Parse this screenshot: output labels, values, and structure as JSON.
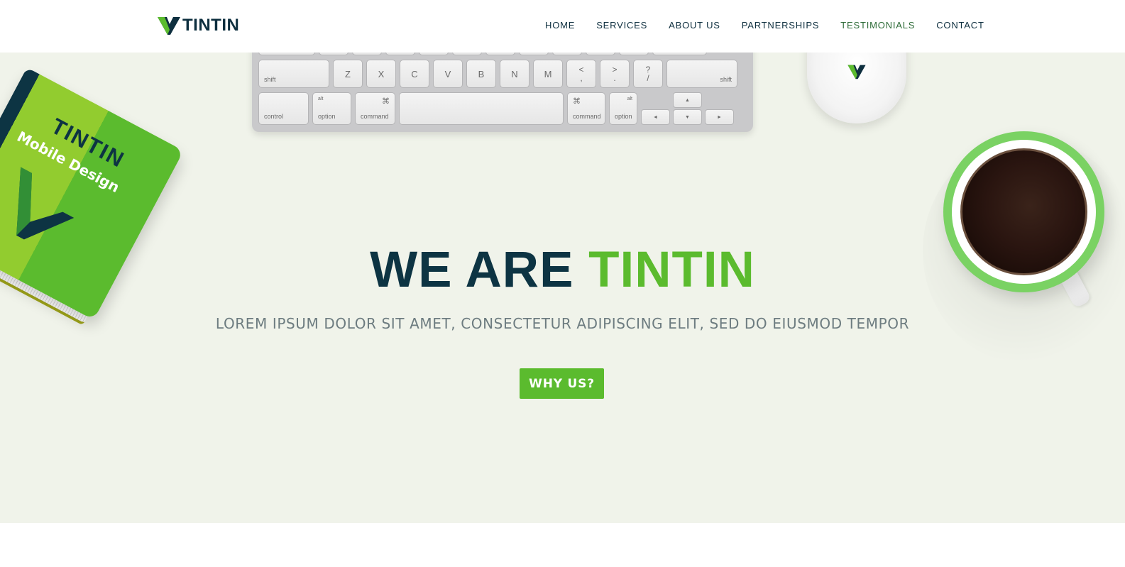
{
  "brand": {
    "name": "TINTIN",
    "logo_icon": "v-logo-icon",
    "color_dark": "#0e2f3f",
    "color_green": "#5bbb2e"
  },
  "nav": {
    "items": [
      {
        "label": "HOME",
        "active": false
      },
      {
        "label": "SERVICES",
        "active": false
      },
      {
        "label": "ABOUT US",
        "active": false
      },
      {
        "label": "PARTNERSHIPS",
        "active": false
      },
      {
        "label": "TESTIMONIALS",
        "active": true
      },
      {
        "label": "CONTACT",
        "active": false
      }
    ]
  },
  "keyboard": {
    "row2": [
      "shift",
      "Z",
      "X",
      "C",
      "V",
      "B",
      "N",
      "M",
      "<",
      ",",
      ">",
      ".",
      "?",
      "/",
      "shift"
    ],
    "row3": {
      "control": "control",
      "alt": "alt",
      "option": "option",
      "command": "command",
      "cmd_symbol": "⌘",
      "arrow_up": "▲",
      "arrow_down": "▼",
      "arrow_left": "◄",
      "arrow_right": "►"
    }
  },
  "book": {
    "title": "TINTIN",
    "subtitle": "Mobile Design"
  },
  "hero": {
    "headline_part1": "WE ARE",
    "headline_part2": "TINTIN",
    "tagline": "LOREM IPSUM DOLOR SIT AMET, CONSECTETUR ADIPISCING ELIT, SED DO EIUSMOD TEMPOR",
    "cta_label": "WHY US?"
  }
}
